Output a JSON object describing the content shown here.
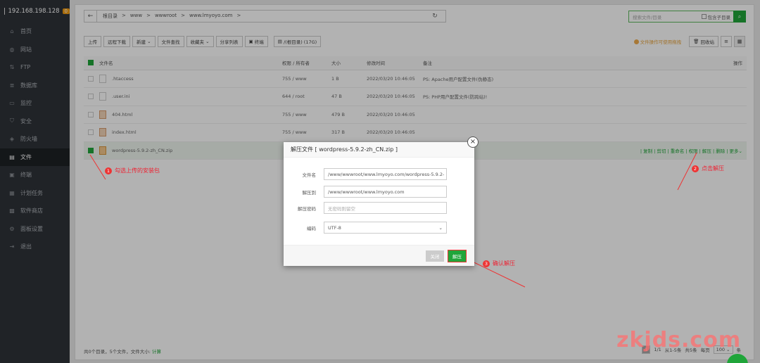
{
  "sidebar": {
    "host": "192.168.198.128",
    "badge": "0",
    "items": [
      {
        "label": "首页",
        "icon": "home-icon",
        "glyph": "⌂"
      },
      {
        "label": "网站",
        "icon": "globe-icon",
        "glyph": "◍"
      },
      {
        "label": "FTP",
        "icon": "ftp-icon",
        "glyph": "⇅"
      },
      {
        "label": "数据库",
        "icon": "database-icon",
        "glyph": "≣"
      },
      {
        "label": "监控",
        "icon": "monitor-icon",
        "glyph": "▭"
      },
      {
        "label": "安全",
        "icon": "shield-icon",
        "glyph": "⛉"
      },
      {
        "label": "防火墙",
        "icon": "firewall-icon",
        "glyph": "◈"
      },
      {
        "label": "文件",
        "icon": "folder-icon",
        "glyph": "▤"
      },
      {
        "label": "终端",
        "icon": "terminal-icon",
        "glyph": "▣"
      },
      {
        "label": "计划任务",
        "icon": "calendar-icon",
        "glyph": "▦"
      },
      {
        "label": "软件商店",
        "icon": "store-icon",
        "glyph": "▩"
      },
      {
        "label": "面板设置",
        "icon": "gear-icon",
        "glyph": "⚙"
      },
      {
        "label": "退出",
        "icon": "logout-icon",
        "glyph": "⇥"
      }
    ]
  },
  "path": {
    "crumbs": [
      "根目录",
      ">",
      "www",
      ">",
      "wwwroot",
      ">",
      "www.lmyoyo.com",
      ">"
    ]
  },
  "search": {
    "placeholder": "搜索文件/目录",
    "subdir_label": "包含子目录"
  },
  "toolbar": {
    "upload": "上传",
    "remote_download": "远程下载",
    "new": "新建",
    "file_search": "文件查找",
    "favorites": "收藏夹",
    "share_list": "分享列表",
    "terminal": "终端",
    "disk": "/(根目录) (17G)",
    "tip": "文件操作可使用拖拽",
    "recycle": "回收站"
  },
  "table": {
    "headers": {
      "name": "文件名",
      "perm": "权限 / 所有者",
      "size": "大小",
      "mtime": "修改时间",
      "note": "备注",
      "ops": "操作"
    },
    "rows": [
      {
        "name": ".htaccess",
        "perm": "755 / www",
        "size": "1 B",
        "mtime": "2022/03/20 10:46:05",
        "note": "PS: Apache用户配置文件(伪静态)"
      },
      {
        "name": ".user.ini",
        "perm": "644 / root",
        "size": "47 B",
        "mtime": "2022/03/20 10:46:05",
        "note": "PS: PHP用户配置文件(防跨站)!"
      },
      {
        "name": "404.html",
        "perm": "755 / www",
        "size": "479 B",
        "mtime": "2022/03/20 10:46:05",
        "note": ""
      },
      {
        "name": "index.html",
        "perm": "755 / www",
        "size": "317 B",
        "mtime": "2022/03/20 10:46:05",
        "note": ""
      },
      {
        "name": "wordpress-5.9.2-zh_CN.zip",
        "perm": "",
        "size": "",
        "mtime": "",
        "note": ""
      }
    ],
    "row_ops": "| 复制 | 剪切 | 重命名 | 权限 | 解压 | 删除 | 更多"
  },
  "footer": {
    "summary": "共0个目录，5个文件，文件大小:",
    "calc": "计算",
    "page_cur": "1",
    "page_total": "1/1",
    "range": "从1-5条",
    "count": "共5条",
    "per_page_label": "每页",
    "per_page": "100",
    "per_page_unit": "条"
  },
  "dialog": {
    "title": "解压文件 [ wordpress-5.9.2-zh_CN.zip ]",
    "filename_label": "文件名",
    "filename_value": "/www/wwwroot/www.lmyoyo.com/wordpress-5.9.2-",
    "extract_to_label": "解压到",
    "extract_to_value": "/www/wwwroot/www.lmyoyo.com",
    "password_label": "解压密码",
    "password_placeholder": "无密码则留空",
    "encoding_label": "编码",
    "encoding_value": "UTF-8",
    "close_label": "关闭",
    "confirm_label": "解压"
  },
  "annotations": {
    "a1_num": "1",
    "a1_text": "勾选上传的安装包",
    "a2_num": "2",
    "a2_text": "点击解压",
    "a3_num": "3",
    "a3_text": "确认解压"
  },
  "watermark": "zkjds.com",
  "colors": {
    "accent": "#20a53a",
    "annotation": "#e33333",
    "sidebar": "#2f3339"
  }
}
